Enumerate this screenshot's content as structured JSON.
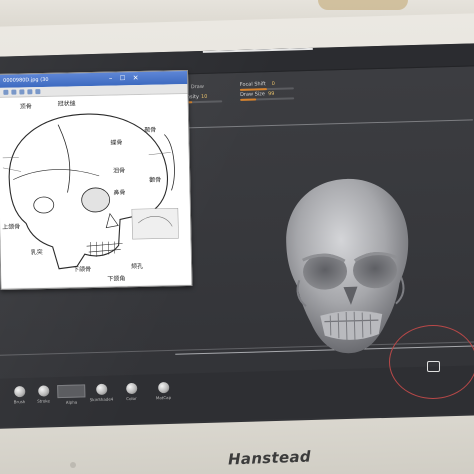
{
  "viewer": {
    "title": "0000980D.jpg (30",
    "labels": {
      "l1": "顶骨",
      "l2": "冠状缝",
      "l3": "蝶骨",
      "l4": "颞骨",
      "l5": "泪骨",
      "l6": "颧骨",
      "l7": "上颌骨",
      "l8": "下颌骨",
      "l9": "鼻骨",
      "l10": "乳突",
      "l11": "下颌角",
      "l12": "颏孔"
    }
  },
  "zbrush": {
    "button_active": "Draw",
    "focal_shift_label": "Focal Shift",
    "focal_shift_value": "0",
    "z_intensity_label": "Z Intensity",
    "z_intensity_value": "10",
    "draw_size_label": "Draw Size",
    "draw_size_value": "99",
    "z_intensity_fraction": 0.4,
    "focal_fraction": 0.5,
    "draw_size_fraction": 0.3
  },
  "tray": [
    "Brush",
    "Stroke",
    "Alpha",
    "SkinShade4",
    "Color",
    "MatCap"
  ],
  "monitor": {
    "brand": "Hanstead"
  },
  "colors": {
    "accent": "#d88a2e",
    "annotation": "#b84848",
    "screen": "#3a3b3f"
  },
  "icons": [
    "minimize-icon",
    "maximize-icon",
    "close-icon",
    "camera-icon"
  ]
}
